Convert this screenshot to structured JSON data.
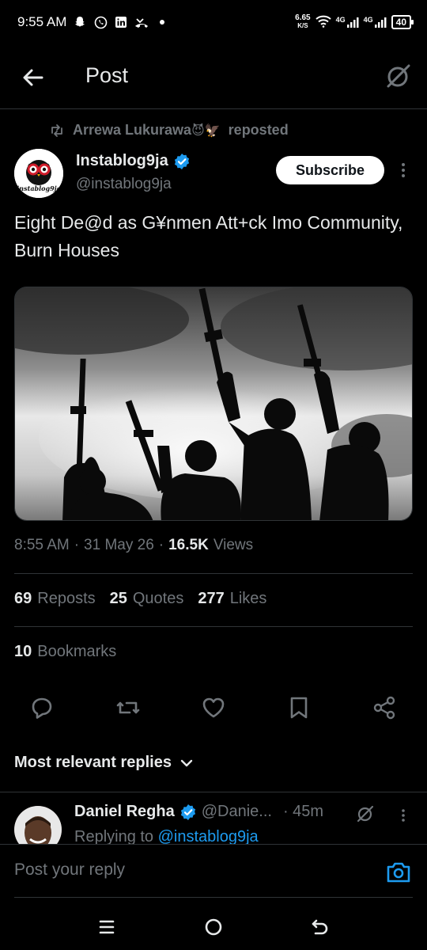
{
  "status_bar": {
    "time": "9:55 AM",
    "net_speed_value": "6.65",
    "net_speed_unit": "K/S",
    "network_1": "4G",
    "network_2": "4G",
    "battery": "40",
    "icons": [
      "snapchat-icon",
      "whatsapp-icon",
      "linkedin-icon",
      "missed-call-icon",
      "dot-icon",
      "wifi-icon",
      "signal-icon",
      "signal-icon",
      "battery-icon"
    ]
  },
  "nav": {
    "title": "Post",
    "back_icon": "arrow-left-icon",
    "grok_icon": "grok-icon"
  },
  "repost": {
    "user": "Arrewa Lukurawa",
    "emoji": "😈🦅",
    "label": "reposted"
  },
  "author": {
    "name": "Instablog9ja",
    "handle": "@instablog9ja",
    "verified": true,
    "avatar_text": "instablog9ja",
    "subscribe_label": "Subscribe"
  },
  "post": {
    "text": "Eight De@d as G¥nmen Att+ck Imo Community, Burn Houses",
    "time": "8:55 AM",
    "date": "31 May 26",
    "views_count": "16.5K",
    "views_label": "Views"
  },
  "stats": {
    "reposts_count": "69",
    "reposts_label": "Reposts",
    "quotes_count": "25",
    "quotes_label": "Quotes",
    "likes_count": "277",
    "likes_label": "Likes",
    "bookmarks_count": "10",
    "bookmarks_label": "Bookmarks"
  },
  "actions": [
    "reply-icon",
    "repost-icon",
    "like-icon",
    "bookmark-icon",
    "share-icon"
  ],
  "replies": {
    "header": "Most relevant replies",
    "items": [
      {
        "name": "Daniel Regha",
        "handle": "@Danie...",
        "time": "· 45m",
        "replying_prefix": "Replying to ",
        "replying_to": "@instablog9ja"
      }
    ]
  },
  "compose": {
    "placeholder": "Post your reply"
  },
  "colors": {
    "background": "#000000",
    "text": "#e7e9ea",
    "secondary": "#71767b",
    "accent": "#1d9bf0",
    "divider": "#2f3336"
  }
}
